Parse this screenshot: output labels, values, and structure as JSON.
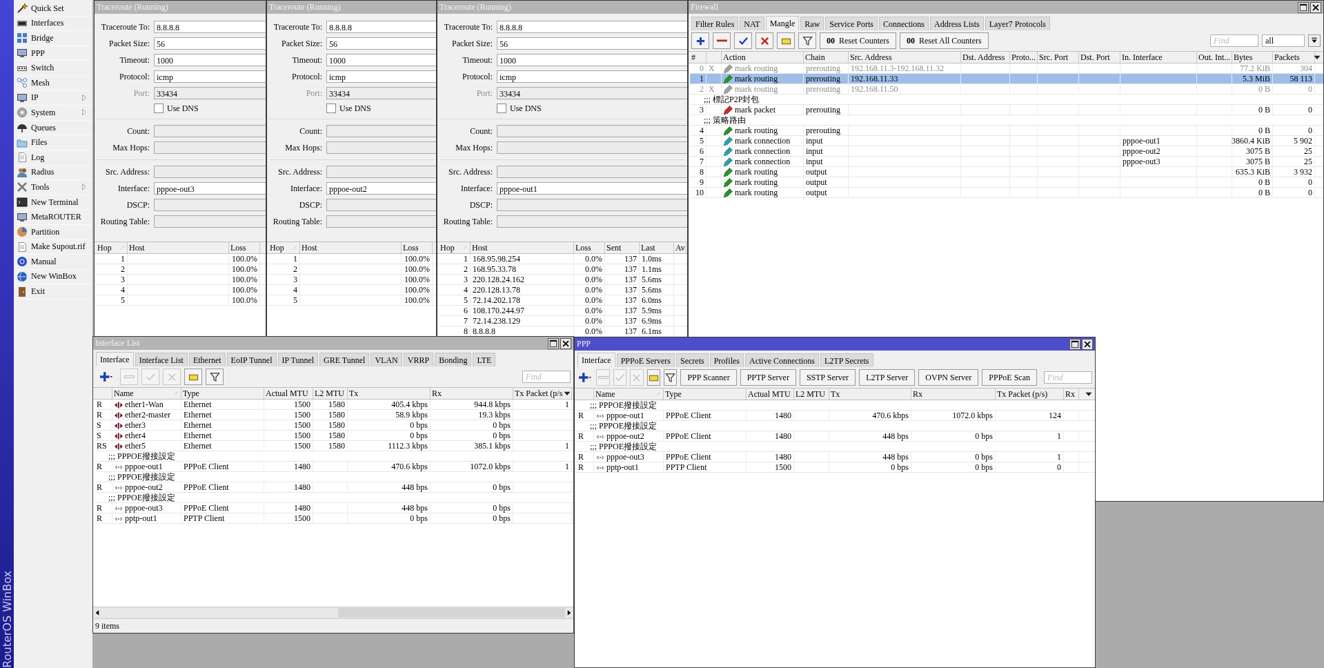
{
  "sidebar": {
    "brand": "RouterOS WinBox",
    "items": [
      {
        "label": "Quick Set",
        "submenu": false
      },
      {
        "label": "Interfaces",
        "submenu": false
      },
      {
        "label": "Bridge",
        "submenu": false
      },
      {
        "label": "PPP",
        "submenu": false
      },
      {
        "label": "Switch",
        "submenu": false
      },
      {
        "label": "Mesh",
        "submenu": false
      },
      {
        "label": "IP",
        "submenu": true
      },
      {
        "label": "System",
        "submenu": true
      },
      {
        "label": "Queues",
        "submenu": false
      },
      {
        "label": "Files",
        "submenu": false
      },
      {
        "label": "Log",
        "submenu": false
      },
      {
        "label": "Radius",
        "submenu": false
      },
      {
        "label": "Tools",
        "submenu": true
      },
      {
        "label": "New Terminal",
        "submenu": false
      },
      {
        "label": "MetaROUTER",
        "submenu": false
      },
      {
        "label": "Partition",
        "submenu": false
      },
      {
        "label": "Make Supout.rif",
        "submenu": false
      },
      {
        "label": "Manual",
        "submenu": false
      },
      {
        "label": "New WinBox",
        "submenu": false
      },
      {
        "label": "Exit",
        "submenu": false
      }
    ]
  },
  "traceroute_windows": [
    {
      "title": "Traceroute (Running)",
      "active": false,
      "fields": [
        {
          "kind": "text",
          "label": "Traceroute To:",
          "value": "8.8.8.8",
          "disabled": false
        },
        {
          "kind": "text",
          "label": "Packet Size:",
          "value": "56",
          "disabled": false
        },
        {
          "kind": "text",
          "label": "Timeout:",
          "value": "1000",
          "disabled": false
        },
        {
          "kind": "text",
          "label": "Protocol:",
          "value": "icmp",
          "disabled": false
        },
        {
          "kind": "text",
          "label": "Port:",
          "value": "33434",
          "disabled": true
        },
        {
          "kind": "checkbox",
          "label": "Use DNS",
          "checked": false
        },
        {
          "kind": "separator"
        },
        {
          "kind": "text",
          "label": "Count:",
          "disabled": false
        },
        {
          "kind": "text",
          "label": "Max Hops:",
          "disabled": false
        },
        {
          "kind": "separator"
        },
        {
          "kind": "text",
          "label": "Src. Address:",
          "disabled": false
        },
        {
          "kind": "text",
          "label": "Interface:",
          "value": "pppoe-out3",
          "disabled": false
        },
        {
          "kind": "text",
          "label": "DSCP:",
          "disabled": false
        },
        {
          "kind": "text",
          "label": "Routing Table:",
          "disabled": false
        }
      ],
      "table": {
        "columns": [
          {
            "label": "Hop",
            "sorted": true
          },
          {
            "label": "Host",
            "sorted": false
          },
          {
            "label": "Loss",
            "sorted": false
          }
        ],
        "rows": [
          {
            "cells": [
              "1",
              null,
              "100.0%"
            ]
          },
          {
            "cells": [
              "2",
              null,
              "100.0%"
            ]
          },
          {
            "cells": [
              "3",
              null,
              "100.0%"
            ]
          },
          {
            "cells": [
              "4",
              null,
              "100.0%"
            ]
          },
          {
            "cells": [
              "5",
              null,
              "100.0%"
            ]
          }
        ]
      }
    },
    {
      "title": "Traceroute (Running)",
      "active": false,
      "fields": [
        {
          "kind": "text",
          "label": "Traceroute To:",
          "value": "8.8.8.8",
          "disabled": false
        },
        {
          "kind": "text",
          "label": "Packet Size:",
          "value": "56",
          "disabled": false
        },
        {
          "kind": "text",
          "label": "Timeout:",
          "value": "1000",
          "disabled": false
        },
        {
          "kind": "text",
          "label": "Protocol:",
          "value": "icmp",
          "disabled": false
        },
        {
          "kind": "text",
          "label": "Port:",
          "value": "33434",
          "disabled": true
        },
        {
          "kind": "checkbox",
          "label": "Use DNS",
          "checked": false
        },
        {
          "kind": "separator"
        },
        {
          "kind": "text",
          "label": "Count:",
          "disabled": false
        },
        {
          "kind": "text",
          "label": "Max Hops:",
          "disabled": false
        },
        {
          "kind": "separator"
        },
        {
          "kind": "text",
          "label": "Src. Address:",
          "disabled": false
        },
        {
          "kind": "text",
          "label": "Interface:",
          "value": "pppoe-out2",
          "disabled": false
        },
        {
          "kind": "text",
          "label": "DSCP:",
          "disabled": false
        },
        {
          "kind": "text",
          "label": "Routing Table:",
          "disabled": false
        }
      ],
      "table": {
        "columns": [
          {
            "label": "Hop",
            "sorted": true
          },
          {
            "label": "Host",
            "sorted": false
          },
          {
            "label": "Loss",
            "sorted": false
          }
        ],
        "rows": [
          {
            "cells": [
              "1",
              null,
              "100.0%"
            ]
          },
          {
            "cells": [
              "2",
              null,
              "100.0%"
            ]
          },
          {
            "cells": [
              "3",
              null,
              "100.0%"
            ]
          },
          {
            "cells": [
              "4",
              null,
              "100.0%"
            ]
          },
          {
            "cells": [
              "5",
              null,
              "100.0%"
            ]
          }
        ]
      }
    },
    {
      "title": "Traceroute (Running)",
      "active": false,
      "fields": [
        {
          "kind": "text",
          "label": "Traceroute To:",
          "value": "8.8.8.8",
          "disabled": false
        },
        {
          "kind": "text",
          "label": "Packet Size:",
          "value": "56",
          "disabled": false
        },
        {
          "kind": "text",
          "label": "Timeout:",
          "value": "1000",
          "disabled": false
        },
        {
          "kind": "text",
          "label": "Protocol:",
          "value": "icmp",
          "disabled": false
        },
        {
          "kind": "text",
          "label": "Port:",
          "value": "33434",
          "disabled": true
        },
        {
          "kind": "checkbox",
          "label": "Use DNS",
          "checked": false
        },
        {
          "kind": "separator"
        },
        {
          "kind": "text",
          "label": "Count:",
          "disabled": false
        },
        {
          "kind": "text",
          "label": "Max Hops:",
          "disabled": false
        },
        {
          "kind": "separator"
        },
        {
          "kind": "text",
          "label": "Src. Address:",
          "disabled": false
        },
        {
          "kind": "text",
          "label": "Interface:",
          "value": "pppoe-out1",
          "disabled": false
        },
        {
          "kind": "text",
          "label": "DSCP:",
          "disabled": false
        },
        {
          "kind": "text",
          "label": "Routing Table:",
          "disabled": false
        }
      ],
      "table": {
        "columns": [
          {
            "label": "Hop",
            "sorted": true
          },
          {
            "label": "Host",
            "sorted": false
          },
          {
            "label": "Loss",
            "sorted": false
          },
          {
            "label": "Sent",
            "sorted": false
          },
          {
            "label": "Last",
            "sorted": false
          },
          {
            "label": "Av",
            "sorted": false
          }
        ],
        "rows": [
          {
            "cells": [
              "1",
              "168.95.98.254",
              "0.0%",
              "137",
              "1.0ms",
              null
            ]
          },
          {
            "cells": [
              "2",
              "168.95.33.78",
              "0.0%",
              "137",
              "1.1ms",
              null
            ]
          },
          {
            "cells": [
              "3",
              "220.128.24.162",
              "0.0%",
              "137",
              "5.6ms",
              null
            ]
          },
          {
            "cells": [
              "4",
              "220.128.13.78",
              "0.0%",
              "137",
              "5.6ms",
              null
            ]
          },
          {
            "cells": [
              "5",
              "72.14.202.178",
              "0.0%",
              "137",
              "6.0ms",
              null
            ]
          },
          {
            "cells": [
              "6",
              "108.170.244.97",
              "0.0%",
              "137",
              "5.9ms",
              null
            ]
          },
          {
            "cells": [
              "7",
              "72.14.238.129",
              "0.0%",
              "137",
              "6.9ms",
              null
            ]
          },
          {
            "cells": [
              "8",
              "8.8.8.8",
              "0.0%",
              "137",
              "6.1ms",
              null
            ]
          }
        ]
      }
    }
  ],
  "firewall": {
    "title": "Firewall",
    "active": false,
    "tabs": [
      {
        "label": "Filter Rules",
        "selected": false
      },
      {
        "label": "NAT",
        "selected": false
      },
      {
        "label": "Mangle",
        "selected": true
      },
      {
        "label": "Raw",
        "selected": false
      },
      {
        "label": "Service Ports",
        "selected": false
      },
      {
        "label": "Connections",
        "selected": false
      },
      {
        "label": "Address Lists",
        "selected": false
      },
      {
        "label": "Layer7 Protocols",
        "selected": false
      }
    ],
    "toolbar": [
      {
        "disabled": false
      },
      {
        "disabled": false
      },
      {
        "disabled": false
      },
      {
        "disabled": false
      },
      {
        "disabled": false
      },
      {
        "disabled": false
      }
    ],
    "buttons": [
      {
        "icon": "00",
        "label": "Reset Counters"
      },
      {
        "icon": "00",
        "label": "Reset All Counters"
      }
    ],
    "search": {
      "placeholder": "Find"
    },
    "filter_dropdown": {
      "value": "all"
    },
    "table": {
      "columns": [
        {
          "label": "#",
          "sorted": false
        },
        {
          "sorted": false
        },
        {
          "label": "Action",
          "sorted": false
        },
        {
          "label": "Chain",
          "sorted": false
        },
        {
          "label": "Src. Address",
          "sorted": false
        },
        {
          "label": "Dst. Address",
          "sorted": false
        },
        {
          "label": "Proto...",
          "sorted": false
        },
        {
          "label": "Src. Port",
          "sorted": false
        },
        {
          "label": "Dst. Port",
          "sorted": false
        },
        {
          "label": "In. Interface",
          "sorted": false
        },
        {
          "label": "Out. Int...",
          "sorted": false
        },
        {
          "label": "Bytes",
          "sorted": false
        },
        {
          "label": "Packets",
          "sorted": false
        }
      ],
      "rows": [
        {
          "kind": "rule",
          "cells": [
            "0",
            "X",
            "mark routing",
            "prerouting",
            "192.168.11.3-192.168.11.32",
            null,
            null,
            null,
            null,
            null,
            null,
            "77.2 KiB",
            "304"
          ],
          "disabled": true,
          "selected": false,
          "color": "#a0a0a0"
        },
        {
          "kind": "rule",
          "cells": [
            "1",
            null,
            "mark routing",
            "prerouting",
            "192.168.11.33",
            null,
            null,
            null,
            null,
            null,
            null,
            "5.3 MiB",
            "58 113"
          ],
          "disabled": false,
          "selected": true,
          "color": "#2f8f2f"
        },
        {
          "kind": "rule",
          "cells": [
            "2",
            "X",
            "mark routing",
            "prerouting",
            "192.168.11.50",
            null,
            null,
            null,
            null,
            null,
            null,
            "0 B",
            "0"
          ],
          "disabled": true,
          "selected": false,
          "color": "#a0a0a0"
        },
        {
          "kind": "comment",
          "text": ";;; 標記P2P封包"
        },
        {
          "kind": "rule",
          "cells": [
            "3",
            null,
            "mark packet",
            "prerouting",
            null,
            null,
            null,
            null,
            null,
            null,
            null,
            "0 B",
            "0"
          ],
          "disabled": false,
          "selected": false,
          "color": "#c03030"
        },
        {
          "kind": "comment",
          "text": ";;; 策略路由"
        },
        {
          "kind": "rule",
          "cells": [
            "4",
            null,
            "mark routing",
            "prerouting",
            null,
            null,
            null,
            null,
            null,
            null,
            null,
            "0 B",
            "0"
          ],
          "disabled": false,
          "selected": false,
          "color": "#2f8f2f"
        },
        {
          "kind": "rule",
          "cells": [
            "5",
            null,
            "mark connection",
            "input",
            null,
            null,
            null,
            null,
            null,
            "pppoe-out1",
            null,
            "3860.4 KiB",
            "5 902"
          ],
          "disabled": false,
          "selected": false,
          "color": "#3a9aa8"
        },
        {
          "kind": "rule",
          "cells": [
            "6",
            null,
            "mark connection",
            "input",
            null,
            null,
            null,
            null,
            null,
            "pppoe-out2",
            null,
            "3075 B",
            "25"
          ],
          "disabled": false,
          "selected": false,
          "color": "#3a9aa8"
        },
        {
          "kind": "rule",
          "cells": [
            "7",
            null,
            "mark connection",
            "input",
            null,
            null,
            null,
            null,
            null,
            "pppoe-out3",
            null,
            "3075 B",
            "25"
          ],
          "disabled": false,
          "selected": false,
          "color": "#3a9aa8"
        },
        {
          "kind": "rule",
          "cells": [
            "8",
            null,
            "mark routing",
            "output",
            null,
            null,
            null,
            null,
            null,
            null,
            null,
            "635.3 KiB",
            "3 932"
          ],
          "disabled": false,
          "selected": false,
          "color": "#2f8f2f"
        },
        {
          "kind": "rule",
          "cells": [
            "9",
            null,
            "mark routing",
            "output",
            null,
            null,
            null,
            null,
            null,
            null,
            null,
            "0 B",
            "0"
          ],
          "disabled": false,
          "selected": false,
          "color": "#2f8f2f"
        },
        {
          "kind": "rule",
          "cells": [
            "10",
            null,
            "mark routing",
            "output",
            null,
            null,
            null,
            null,
            null,
            null,
            null,
            "0 B",
            "0"
          ],
          "disabled": false,
          "selected": false,
          "color": "#2f8f2f"
        }
      ]
    }
  },
  "interface_list": {
    "title": "Interface List",
    "active": false,
    "tabs": [
      {
        "label": "Interface",
        "selected": true
      },
      {
        "label": "Interface List",
        "selected": false
      },
      {
        "label": "Ethernet",
        "selected": false
      },
      {
        "label": "EoIP Tunnel",
        "selected": false
      },
      {
        "label": "IP Tunnel",
        "selected": false
      },
      {
        "label": "GRE Tunnel",
        "selected": false
      },
      {
        "label": "VLAN",
        "selected": false
      },
      {
        "label": "VRRP",
        "selected": false
      },
      {
        "label": "Bonding",
        "selected": false
      },
      {
        "label": "LTE",
        "selected": false
      }
    ],
    "toolbar": [
      {
        "disabled": false
      },
      {
        "disabled": true
      },
      {
        "disabled": true
      },
      {
        "disabled": true
      },
      {
        "disabled": false
      },
      {
        "disabled": false
      }
    ],
    "search": {
      "placeholder": "Find"
    },
    "table": {
      "columns": [
        {
          "sorted": false
        },
        {
          "label": "Name",
          "sorted": true
        },
        {
          "label": "Type",
          "sorted": false
        },
        {
          "label": "Actual MTU",
          "sorted": false
        },
        {
          "label": "L2 MTU",
          "sorted": false
        },
        {
          "label": "Tx",
          "sorted": false
        },
        {
          "label": "Rx",
          "sorted": false
        },
        {
          "label": "Tx Packet (p/s",
          "sorted": false
        }
      ],
      "rows": [
        {
          "kind": "ethernet",
          "cells": [
            "R",
            "ether1-Wan",
            "Ethernet",
            "1500",
            "1580",
            "405.4 kbps",
            "944.8 kbps",
            "1"
          ],
          "selected": false
        },
        {
          "kind": "ethernet",
          "cells": [
            "R",
            "ether2-master",
            "Ethernet",
            "1500",
            "1580",
            "58.9 kbps",
            "19.3 kbps",
            null
          ],
          "selected": false
        },
        {
          "kind": "ethernet",
          "cells": [
            "S",
            "ether3",
            "Ethernet",
            "1500",
            "1580",
            "0 bps",
            "0 bps",
            null
          ],
          "selected": false
        },
        {
          "kind": "ethernet",
          "cells": [
            "S",
            "ether4",
            "Ethernet",
            "1500",
            "1580",
            "0 bps",
            "0 bps",
            null
          ],
          "selected": false
        },
        {
          "kind": "ethernet",
          "cells": [
            "RS",
            "ether5",
            "Ethernet",
            "1500",
            "1580",
            "1112.3 kbps",
            "385.1 kbps",
            "1"
          ],
          "selected": false
        },
        {
          "kind": "comment",
          "text": ";;; PPPOE撥接設定"
        },
        {
          "kind": "tunnel",
          "cells": [
            "R",
            "pppoe-out1",
            "PPPoE Client",
            "1480",
            null,
            "470.6 kbps",
            "1072.0 kbps",
            "1"
          ],
          "selected": false
        },
        {
          "kind": "comment",
          "text": ";;; PPPOE撥接設定"
        },
        {
          "kind": "tunnel",
          "cells": [
            "R",
            "pppoe-out2",
            "PPPoE Client",
            "1480",
            null,
            "448 bps",
            "0 bps",
            null
          ],
          "selected": false
        },
        {
          "kind": "comment",
          "text": ";;; PPPOE撥接設定"
        },
        {
          "kind": "tunnel",
          "cells": [
            "R",
            "pppoe-out3",
            "PPPoE Client",
            "1480",
            null,
            "448 bps",
            "0 bps",
            null
          ],
          "selected": false
        },
        {
          "kind": "tunnel",
          "cells": [
            "R",
            "pptp-out1",
            "PPTP Client",
            "1500",
            null,
            "0 bps",
            "0 bps",
            null
          ],
          "selected": false
        }
      ]
    },
    "status": "9 items"
  },
  "ppp": {
    "title": "PPP",
    "active": true,
    "tabs": [
      {
        "label": "Interface",
        "selected": true
      },
      {
        "label": "PPPoE Servers",
        "selected": false
      },
      {
        "label": "Secrets",
        "selected": false
      },
      {
        "label": "Profiles",
        "selected": false
      },
      {
        "label": "Active Connections",
        "selected": false
      },
      {
        "label": "L2TP Secrets",
        "selected": false
      }
    ],
    "toolbar": [
      {
        "disabled": false
      },
      {
        "disabled": true
      },
      {
        "disabled": true
      },
      {
        "disabled": true
      },
      {
        "disabled": false
      },
      {
        "disabled": false
      }
    ],
    "buttons": [
      {
        "label": "PPP Scanner"
      },
      {
        "label": "PPTP Server"
      },
      {
        "label": "SSTP Server"
      },
      {
        "label": "L2TP Server"
      },
      {
        "label": "OVPN Server"
      },
      {
        "label": "PPPoE Scan"
      }
    ],
    "search": {
      "placeholder": "Find"
    },
    "table": {
      "columns": [
        {
          "sorted": false
        },
        {
          "label": "Name",
          "sorted": true
        },
        {
          "label": "Type",
          "sorted": false
        },
        {
          "label": "Actual MTU",
          "sorted": false
        },
        {
          "label": "L2 MTU",
          "sorted": false
        },
        {
          "label": "Tx",
          "sorted": false
        },
        {
          "label": "Rx",
          "sorted": false
        },
        {
          "label": "Tx Packet (p/s)",
          "sorted": false
        },
        {
          "label": "Rx",
          "sorted": false
        }
      ],
      "rows": [
        {
          "kind": "comment",
          "text": ";;; PPPOE撥接設定"
        },
        {
          "kind": "tunnel",
          "cells": [
            "R",
            "pppoe-out1",
            "PPPoE Client",
            "1480",
            null,
            "470.6 kbps",
            "1072.0 kbps",
            "124",
            null
          ],
          "selected": false
        },
        {
          "kind": "comment",
          "text": ";;; PPPOE撥接設定"
        },
        {
          "kind": "tunnel",
          "cells": [
            "R",
            "pppoe-out2",
            "PPPoE Client",
            "1480",
            null,
            "448 bps",
            "0 bps",
            "1",
            null
          ],
          "selected": false
        },
        {
          "kind": "comment",
          "text": ";;; PPPOE撥接設定"
        },
        {
          "kind": "tunnel",
          "cells": [
            "R",
            "pppoe-out3",
            "PPPoE Client",
            "1480",
            null,
            "448 bps",
            "0 bps",
            "1",
            null
          ],
          "selected": false
        },
        {
          "kind": "tunnel",
          "cells": [
            "R",
            "pptp-out1",
            "PPTP Client",
            "1500",
            null,
            "0 bps",
            "0 bps",
            "0",
            null
          ],
          "selected": false
        }
      ]
    }
  }
}
